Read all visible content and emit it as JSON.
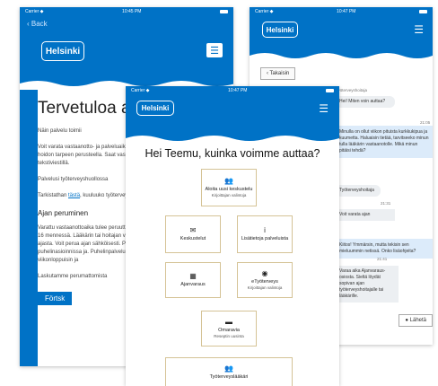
{
  "left": {
    "status": {
      "carrier": "Carrier ◆",
      "time": "10:45 PM"
    },
    "back_label": "‹ Back",
    "logo": "Helsinki",
    "menu_icon": "☰",
    "title": "Tervetuloa ajanv",
    "paragraphs": [
      "Näin palvelu toimii",
      "Voit varata vastaanotto- ja palveluaikoja terveysaseman ajoista annetaan hoidon tarpeen perusteella. Saat vastaanottoajan vahvistuksen tekstiviestillä.",
      "Palvelusi työterveyshuollossa",
      "Tarkistathan tästä, kuuluuko työterveyshuoltoon.",
      "Ajan peruminen",
      "Varattu vastaanottoaika tulee peruuttaa viimeistään edellisenä päivänä klo 16 mennessä. Lääkärin tai hoitajan vastaanottoajan perumattomasta ajasta. Voit perua ajan sähköisesti. Perä aika -painikkeen kautta tai myös puhelinasioinnissa ja. Puhelinpalvelu on avoinna 16–8 sekä viikonloppuisin ja",
      "Laskutamme perumattomista"
    ],
    "link_word": "tästä",
    "lang_button": "Förtsk"
  },
  "right": {
    "status": {
      "carrier": "Carrier ◆",
      "time": "10:47 PM"
    },
    "logo": "Helsinki",
    "menu_icon": "☰",
    "back_button": "‹ Takaisin",
    "messages": [
      {
        "dir": "in",
        "text": "Hei! Miten voin auttaa?"
      },
      {
        "dir": "out",
        "text": "Minulla on ollut viikon pituista kurkkukipua ja kuumetta. Haluaisin tietää, tarvitseeko minun tulla lääkärin vastaanotolle. Mikä minun pitäisi tehdä?"
      },
      {
        "dir": "in",
        "text": "Työterveyshoitaja"
      },
      {
        "dir": "in",
        "text": "Voit varata ajan"
      },
      {
        "dir": "out",
        "text": "Kiitos! Ymmärsin, mutta tekisin sen mieluummin netissä. Onko lisäohjeita?"
      },
      {
        "dir": "in",
        "text": "Varaa aika Ajanvaraus-osiosta. Sieltä löydät sopivan ajan työterveyshoitajalle tai lääkärille."
      }
    ],
    "meta_label": "Työterveyshoitaja",
    "times": [
      "21:05",
      "21:31",
      "21:41"
    ],
    "send_button": "Lähetä"
  },
  "center": {
    "status": {
      "carrier": "Carrier ◆",
      "time": "10:47 PM"
    },
    "logo": "Helsinki",
    "menu_icon": "☰",
    "greeting": "Hei Teemu, kuinka voimme auttaa?",
    "tiles": [
      {
        "icon": "👥",
        "title": "Aloita uusi keskustelu",
        "sub": "Kirjoittajan valintoja"
      },
      {
        "icon": "✉",
        "title": "Keskustelut",
        "sub": ""
      },
      {
        "icon": "i",
        "title": "Lisätietoja palveluista",
        "sub": ""
      },
      {
        "icon": "▦",
        "title": "Ajanvaraus",
        "sub": ""
      },
      {
        "icon": "◉",
        "title": "eTyöterveys",
        "sub": "Kirjoittajan valintoja"
      },
      {
        "icon": "▬",
        "title": "Omaravia",
        "sub": "Reseptin uusinta"
      },
      {
        "icon": "👥",
        "title": "Työterveyslääkäri",
        "sub": ""
      }
    ]
  },
  "colors": {
    "brand": "#0072c6",
    "tile_border": "#d5c396"
  }
}
